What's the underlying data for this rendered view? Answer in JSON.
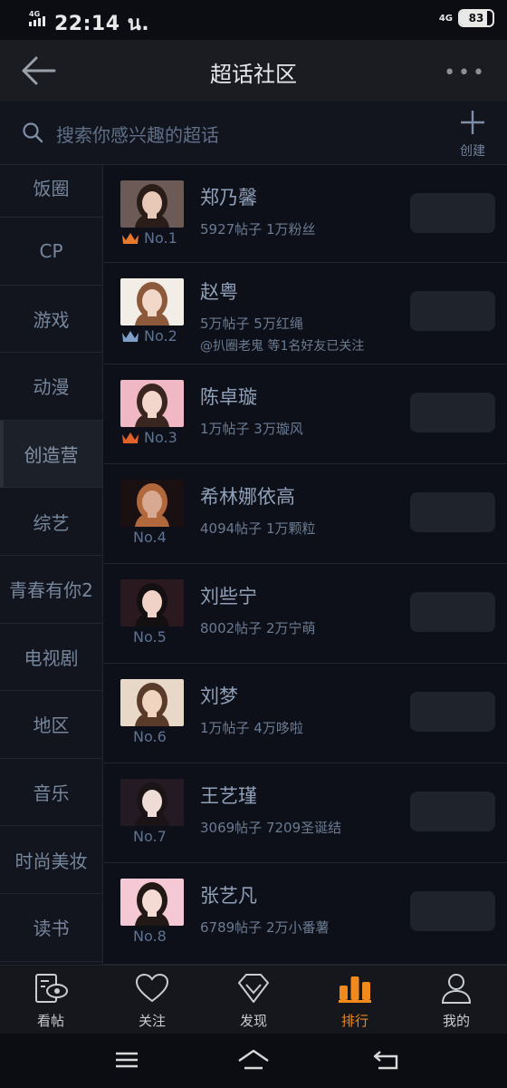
{
  "status": {
    "time": "22:14 น.",
    "network_left": "4G",
    "network_right": "4G",
    "battery": "83",
    "battery_level": 0.83
  },
  "header": {
    "title": "超话社区"
  },
  "search": {
    "placeholder": "搜索你感兴趣的超话",
    "create_label": "创建"
  },
  "sidebar": {
    "active_index": 4,
    "items": [
      {
        "label": "饭圈"
      },
      {
        "label": "CP"
      },
      {
        "label": "游戏"
      },
      {
        "label": "动漫"
      },
      {
        "label": "创造营"
      },
      {
        "label": "综艺"
      },
      {
        "label": "青春有你2"
      },
      {
        "label": "电视剧"
      },
      {
        "label": "地区"
      },
      {
        "label": "音乐"
      },
      {
        "label": "时尚美妆"
      },
      {
        "label": "读书"
      }
    ]
  },
  "ranking": [
    {
      "rank": "No.1",
      "name": "郑乃馨",
      "stats": "5927帖子 1万粉丝",
      "note": "",
      "crown": "gold",
      "avatar_bg": "#6b5a55",
      "avatar_skin": "#e8c9b8",
      "avatar_hair": "#2a1c18"
    },
    {
      "rank": "No.2",
      "name": "赵粤",
      "stats": "5万帖子 5万红绳",
      "note": "@扒圈老鬼 等1名好友已关注",
      "crown": "silver",
      "avatar_bg": "#f2ede6",
      "avatar_skin": "#f1d8c8",
      "avatar_hair": "#8c5a3a"
    },
    {
      "rank": "No.3",
      "name": "陈卓璇",
      "stats": "1万帖子 3万璇风",
      "note": "",
      "crown": "bronze",
      "avatar_bg": "#f0b8c4",
      "avatar_skin": "#f3d6cc",
      "avatar_hair": "#3a2620"
    },
    {
      "rank": "No.4",
      "name": "希林娜依高",
      "stats": "4094帖子 1万颗粒",
      "note": "",
      "crown": "",
      "avatar_bg": "#1a1012",
      "avatar_skin": "#d8a890",
      "avatar_hair": "#b0683c"
    },
    {
      "rank": "No.5",
      "name": "刘些宁",
      "stats": "8002帖子 2万宁萌",
      "note": "",
      "crown": "",
      "avatar_bg": "#2a1a20",
      "avatar_skin": "#f0d2c6",
      "avatar_hair": "#141012"
    },
    {
      "rank": "No.6",
      "name": "刘梦",
      "stats": "1万帖子 4万哆啦",
      "note": "",
      "crown": "",
      "avatar_bg": "#e8d8c8",
      "avatar_skin": "#f0d4c0",
      "avatar_hair": "#5a3a28"
    },
    {
      "rank": "No.7",
      "name": "王艺瑾",
      "stats": "3069帖子 7209圣诞结",
      "note": "",
      "crown": "",
      "avatar_bg": "#241a24",
      "avatar_skin": "#f0dcd6",
      "avatar_hair": "#1a1416"
    },
    {
      "rank": "No.8",
      "name": "张艺凡",
      "stats": "6789帖子 2万小番薯",
      "note": "",
      "crown": "",
      "avatar_bg": "#f4c8d4",
      "avatar_skin": "#f4dcd4",
      "avatar_hair": "#221816"
    }
  ],
  "bottom_nav": {
    "active_index": 3,
    "accent": "#f08a1c",
    "items": [
      {
        "label": "看帖",
        "icon": "view-posts-icon"
      },
      {
        "label": "关注",
        "icon": "heart-icon"
      },
      {
        "label": "发现",
        "icon": "discover-diamond-icon"
      },
      {
        "label": "排行",
        "icon": "ranking-bars-icon"
      },
      {
        "label": "我的",
        "icon": "profile-icon"
      }
    ]
  },
  "system_nav": {
    "icons": [
      "menu-icon",
      "home-icon",
      "back-icon"
    ]
  }
}
